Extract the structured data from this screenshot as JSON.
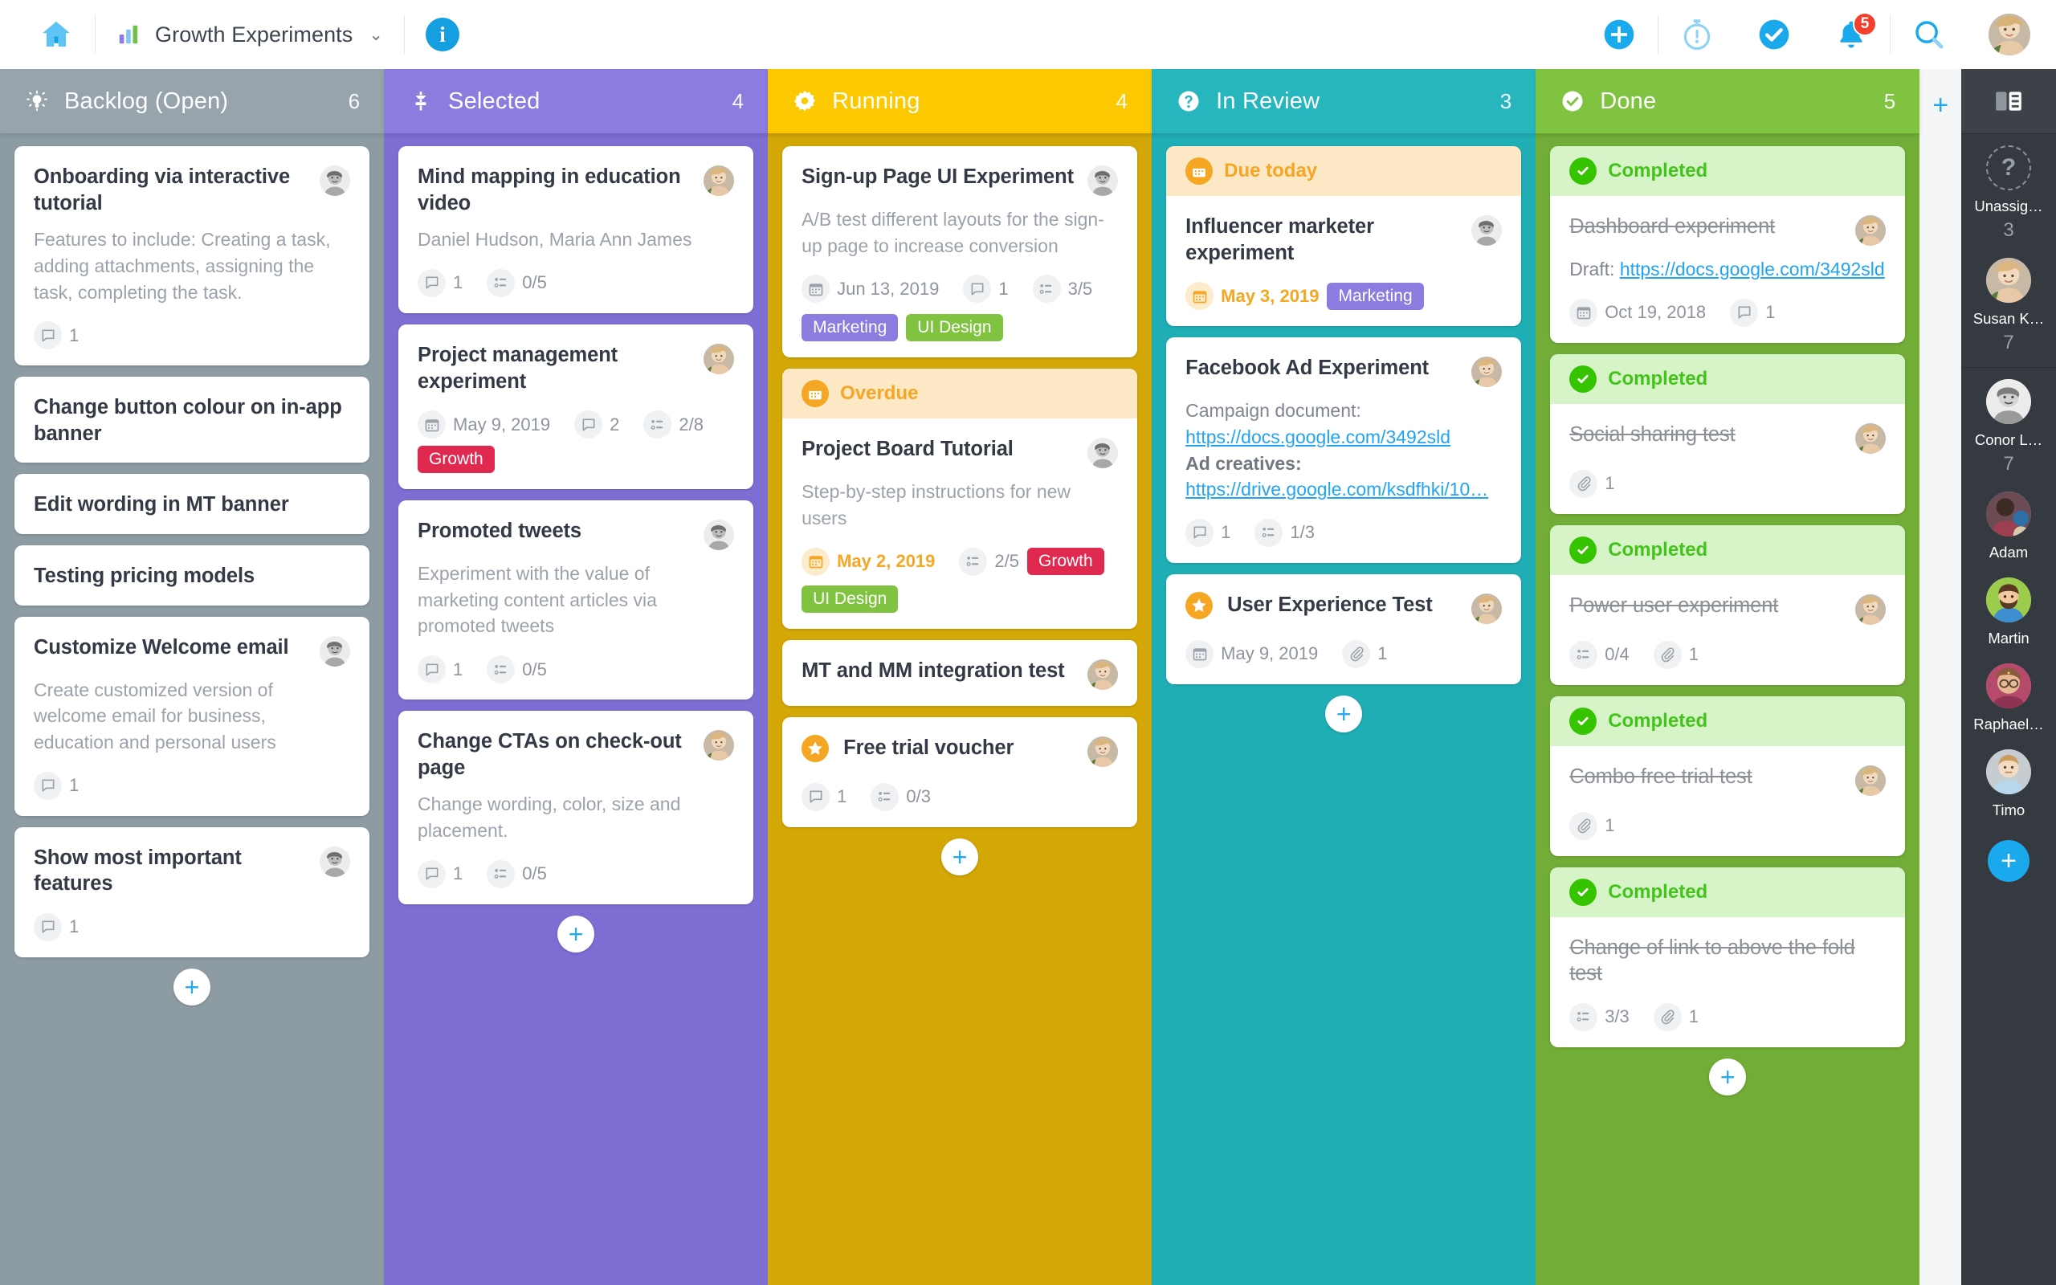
{
  "topbar": {
    "home_icon": "home-icon",
    "board_name": "Growth Experiments",
    "board_chevron": "⌄",
    "info_label": "i",
    "add_label": "+",
    "notification_count": "5",
    "icons": [
      "plus-icon",
      "timer-icon",
      "check-icon",
      "bell-icon",
      "search-icon",
      "user-avatar"
    ]
  },
  "columns": [
    {
      "id": "backlog",
      "title": "Backlog (Open)",
      "count": "6",
      "icon": "lightbulb-icon",
      "add_label": "+",
      "cards": [
        {
          "title": "Onboarding via interactive tutorial",
          "desc": "Features to include: Creating a task, adding attachments, assigning the task, completing the task.",
          "avatar": "male1",
          "meta": [
            {
              "icon": "comment-icon",
              "text": "1"
            }
          ]
        },
        {
          "title": "Change button colour on in-app banner"
        },
        {
          "title": "Edit wording in MT banner"
        },
        {
          "title": "Testing pricing models"
        },
        {
          "title": "Customize Welcome email",
          "desc": "Create customized version of welcome email for business, education and personal users",
          "avatar": "male1",
          "meta": [
            {
              "icon": "comment-icon",
              "text": "1"
            }
          ]
        },
        {
          "title": "Show most important features",
          "avatar": "male1",
          "meta": [
            {
              "icon": "comment-icon",
              "text": "1"
            }
          ]
        }
      ]
    },
    {
      "id": "selected",
      "title": "Selected",
      "count": "4",
      "icon": "funnel-icon",
      "add_label": "+",
      "cards": [
        {
          "title": "Mind mapping in education video",
          "desc": "Daniel Hudson, Maria Ann James",
          "avatar": "female1",
          "meta": [
            {
              "icon": "comment-icon",
              "text": "1"
            },
            {
              "icon": "checklist-icon",
              "text": "0/5"
            }
          ]
        },
        {
          "title": "Project management experiment",
          "avatar": "female1",
          "meta": [
            {
              "icon": "calendar-icon",
              "text": "May 9, 2019"
            },
            {
              "icon": "comment-icon",
              "text": "2"
            },
            {
              "icon": "checklist-icon",
              "text": "2/8"
            }
          ],
          "tags": [
            {
              "label": "Growth",
              "style": "growth"
            }
          ]
        },
        {
          "title": "Promoted tweets",
          "desc": "Experiment with the value of marketing content articles via promoted tweets",
          "avatar": "male1",
          "meta": [
            {
              "icon": "comment-icon",
              "text": "1"
            },
            {
              "icon": "checklist-icon",
              "text": "0/5"
            }
          ]
        },
        {
          "title": "Change CTAs on check-out page",
          "desc": "Change wording, color, size and placement.",
          "avatar": "female1",
          "meta": [
            {
              "icon": "comment-icon",
              "text": "1"
            },
            {
              "icon": "checklist-icon",
              "text": "0/5"
            }
          ]
        }
      ]
    },
    {
      "id": "running",
      "title": "Running",
      "count": "4",
      "icon": "gear-icon",
      "add_label": "+",
      "cards": [
        {
          "title": "Sign-up Page UI Experiment",
          "desc": "A/B test different layouts for the sign-up page to increase conversion",
          "avatar": "male1",
          "meta": [
            {
              "icon": "calendar-icon",
              "text": "Jun 13, 2019"
            },
            {
              "icon": "comment-icon",
              "text": "1"
            },
            {
              "icon": "checklist-icon",
              "text": "3/5"
            }
          ],
          "tags": [
            {
              "label": "Marketing",
              "style": "marketing"
            },
            {
              "label": "UI Design",
              "style": "uidesign"
            }
          ]
        },
        {
          "banner": {
            "label": "Overdue",
            "style": "warn",
            "icon": "calendar-icon"
          },
          "title": "Project Board Tutorial",
          "desc": "Step-by-step instructions for new users",
          "avatar": "male1",
          "meta": [
            {
              "icon": "calendar-icon",
              "text": "May 2, 2019",
              "warn": true
            },
            {
              "icon": "checklist-icon",
              "text": "2/5"
            }
          ],
          "tags": [
            {
              "label": "Growth",
              "style": "growth"
            },
            {
              "label": "UI Design",
              "style": "uidesign"
            }
          ]
        },
        {
          "title": "MT and MM integration test",
          "avatar": "female1"
        },
        {
          "title": "Free trial voucher",
          "starred": true,
          "avatar": "female1",
          "meta": [
            {
              "icon": "comment-icon",
              "text": "1"
            },
            {
              "icon": "checklist-icon",
              "text": "0/3"
            }
          ]
        }
      ]
    },
    {
      "id": "review",
      "title": "In Review",
      "count": "3",
      "icon": "question-icon",
      "add_label": "+",
      "cards": [
        {
          "banner": {
            "label": "Due today",
            "style": "warn",
            "icon": "calendar-icon"
          },
          "title": "Influencer marketer experiment",
          "avatar": "male1",
          "meta": [
            {
              "icon": "calendar-icon",
              "text": "May 3, 2019",
              "warn": true
            }
          ],
          "tags": [
            {
              "label": "Marketing",
              "style": "marketing"
            }
          ]
        },
        {
          "title": "Facebook Ad Experiment",
          "avatar": "female1",
          "desc_parts": [
            {
              "type": "label",
              "text": "Campaign document:"
            },
            {
              "type": "link",
              "text": "https://docs.google.com/3492sld"
            },
            {
              "type": "label-bold",
              "text": "Ad creatives:"
            },
            {
              "type": "link",
              "text": "https://drive.google.com/ksdfhki/10…"
            }
          ],
          "meta": [
            {
              "icon": "comment-icon",
              "text": "1"
            },
            {
              "icon": "checklist-icon",
              "text": "1/3"
            }
          ]
        },
        {
          "title": "User Experience Test",
          "starred": true,
          "avatar": "female1",
          "meta": [
            {
              "icon": "calendar-icon",
              "text": "May 9, 2019"
            },
            {
              "icon": "attachment-icon",
              "text": "1"
            }
          ]
        }
      ]
    },
    {
      "id": "done",
      "title": "Done",
      "count": "5",
      "icon": "check-circle-icon",
      "add_label": "+",
      "cards": [
        {
          "banner": {
            "label": "Completed",
            "style": "done",
            "icon": "check-icon"
          },
          "title": "Dashboard experiment",
          "struck": true,
          "avatar": "female1",
          "desc_parts": [
            {
              "type": "inline-label",
              "text": "Draft: "
            },
            {
              "type": "link",
              "text": "https://docs.google.com/3492sld"
            }
          ],
          "meta": [
            {
              "icon": "calendar-icon",
              "text": "Oct 19, 2018"
            },
            {
              "icon": "comment-icon",
              "text": "1"
            }
          ]
        },
        {
          "banner": {
            "label": "Completed",
            "style": "done",
            "icon": "check-icon"
          },
          "title": "Social sharing test",
          "struck": true,
          "avatar": "female1",
          "meta": [
            {
              "icon": "attachment-icon",
              "text": "1"
            }
          ]
        },
        {
          "banner": {
            "label": "Completed",
            "style": "done",
            "icon": "check-icon"
          },
          "title": "Power user experiment",
          "struck": true,
          "avatar": "female1",
          "meta": [
            {
              "icon": "checklist-icon",
              "text": "0/4"
            },
            {
              "icon": "attachment-icon",
              "text": "1"
            }
          ]
        },
        {
          "banner": {
            "label": "Completed",
            "style": "done",
            "icon": "check-icon"
          },
          "title": "Combo free trial test",
          "struck": true,
          "avatar": "female1",
          "meta": [
            {
              "icon": "attachment-icon",
              "text": "1"
            }
          ]
        },
        {
          "banner": {
            "label": "Completed",
            "style": "done",
            "icon": "check-icon"
          },
          "title": "Change of link to above the fold test",
          "struck": true,
          "meta": [
            {
              "icon": "checklist-icon",
              "text": "3/3"
            },
            {
              "icon": "attachment-icon",
              "text": "1"
            }
          ]
        }
      ]
    }
  ],
  "add_column": {
    "label": "+"
  },
  "sidebar": {
    "panel_icon": "panel-toggle-icon",
    "add_label": "+",
    "members": [
      {
        "name": "Unassig…",
        "count": "3",
        "avatar": "unassigned"
      },
      {
        "name": "Susan K…",
        "count": "7",
        "avatar": "female1"
      },
      {
        "name": "Conor L…",
        "count": "7",
        "avatar": "male1"
      },
      {
        "name": "Adam",
        "count": "",
        "avatar": "adam"
      },
      {
        "name": "Martin",
        "count": "",
        "avatar": "martin"
      },
      {
        "name": "Raphael…",
        "count": "",
        "avatar": "raphael"
      },
      {
        "name": "Timo",
        "count": "",
        "avatar": "timo"
      }
    ]
  },
  "colors": {
    "backlog": "#98a4ac",
    "selected": "#8b7ce0",
    "running": "#fcc900",
    "review": "#27b6bd",
    "done": "#80c341",
    "accent": "#19a9ec",
    "growth_tag": "#e0294f",
    "warn": "#f5a623"
  }
}
